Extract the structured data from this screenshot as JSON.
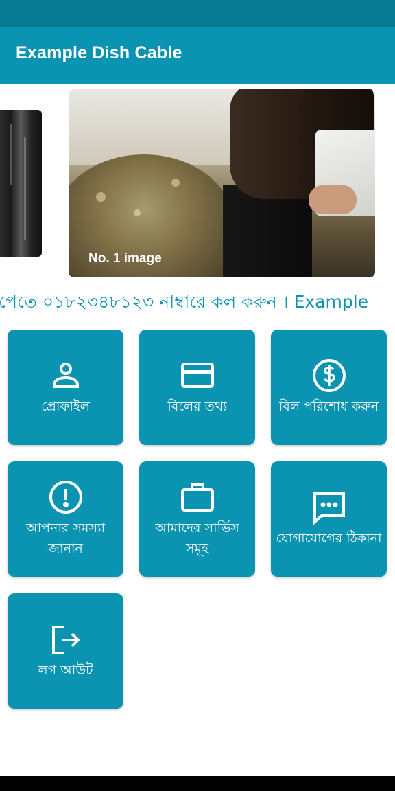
{
  "app_bar": {
    "title": "Example Dish Cable"
  },
  "slider": {
    "caption": "No. 1 image"
  },
  "marquee": {
    "text": "পেতে ০১৮২৩৪৮১২৩ নাম্বারে কল করুন । Example"
  },
  "tiles": [
    {
      "label": "প্রোফাইল",
      "icon": "person-icon"
    },
    {
      "label": "বিলের তথ্য",
      "icon": "credit-card-icon"
    },
    {
      "label": "বিল পরিশোধ করুন",
      "icon": "dollar-circle-icon"
    },
    {
      "label": "আপনার সমস্যা জানান",
      "icon": "alert-circle-icon"
    },
    {
      "label": "আমাদের সার্ভিস সমূহ",
      "icon": "briefcase-icon"
    },
    {
      "label": "যোগাযোগের ঠিকানা",
      "icon": "message-icon"
    },
    {
      "label": "লগ আউট",
      "icon": "logout-icon"
    }
  ],
  "colors": {
    "status_bar": "#067a90",
    "primary": "#0a94b2",
    "nav_bar": "#000000"
  }
}
